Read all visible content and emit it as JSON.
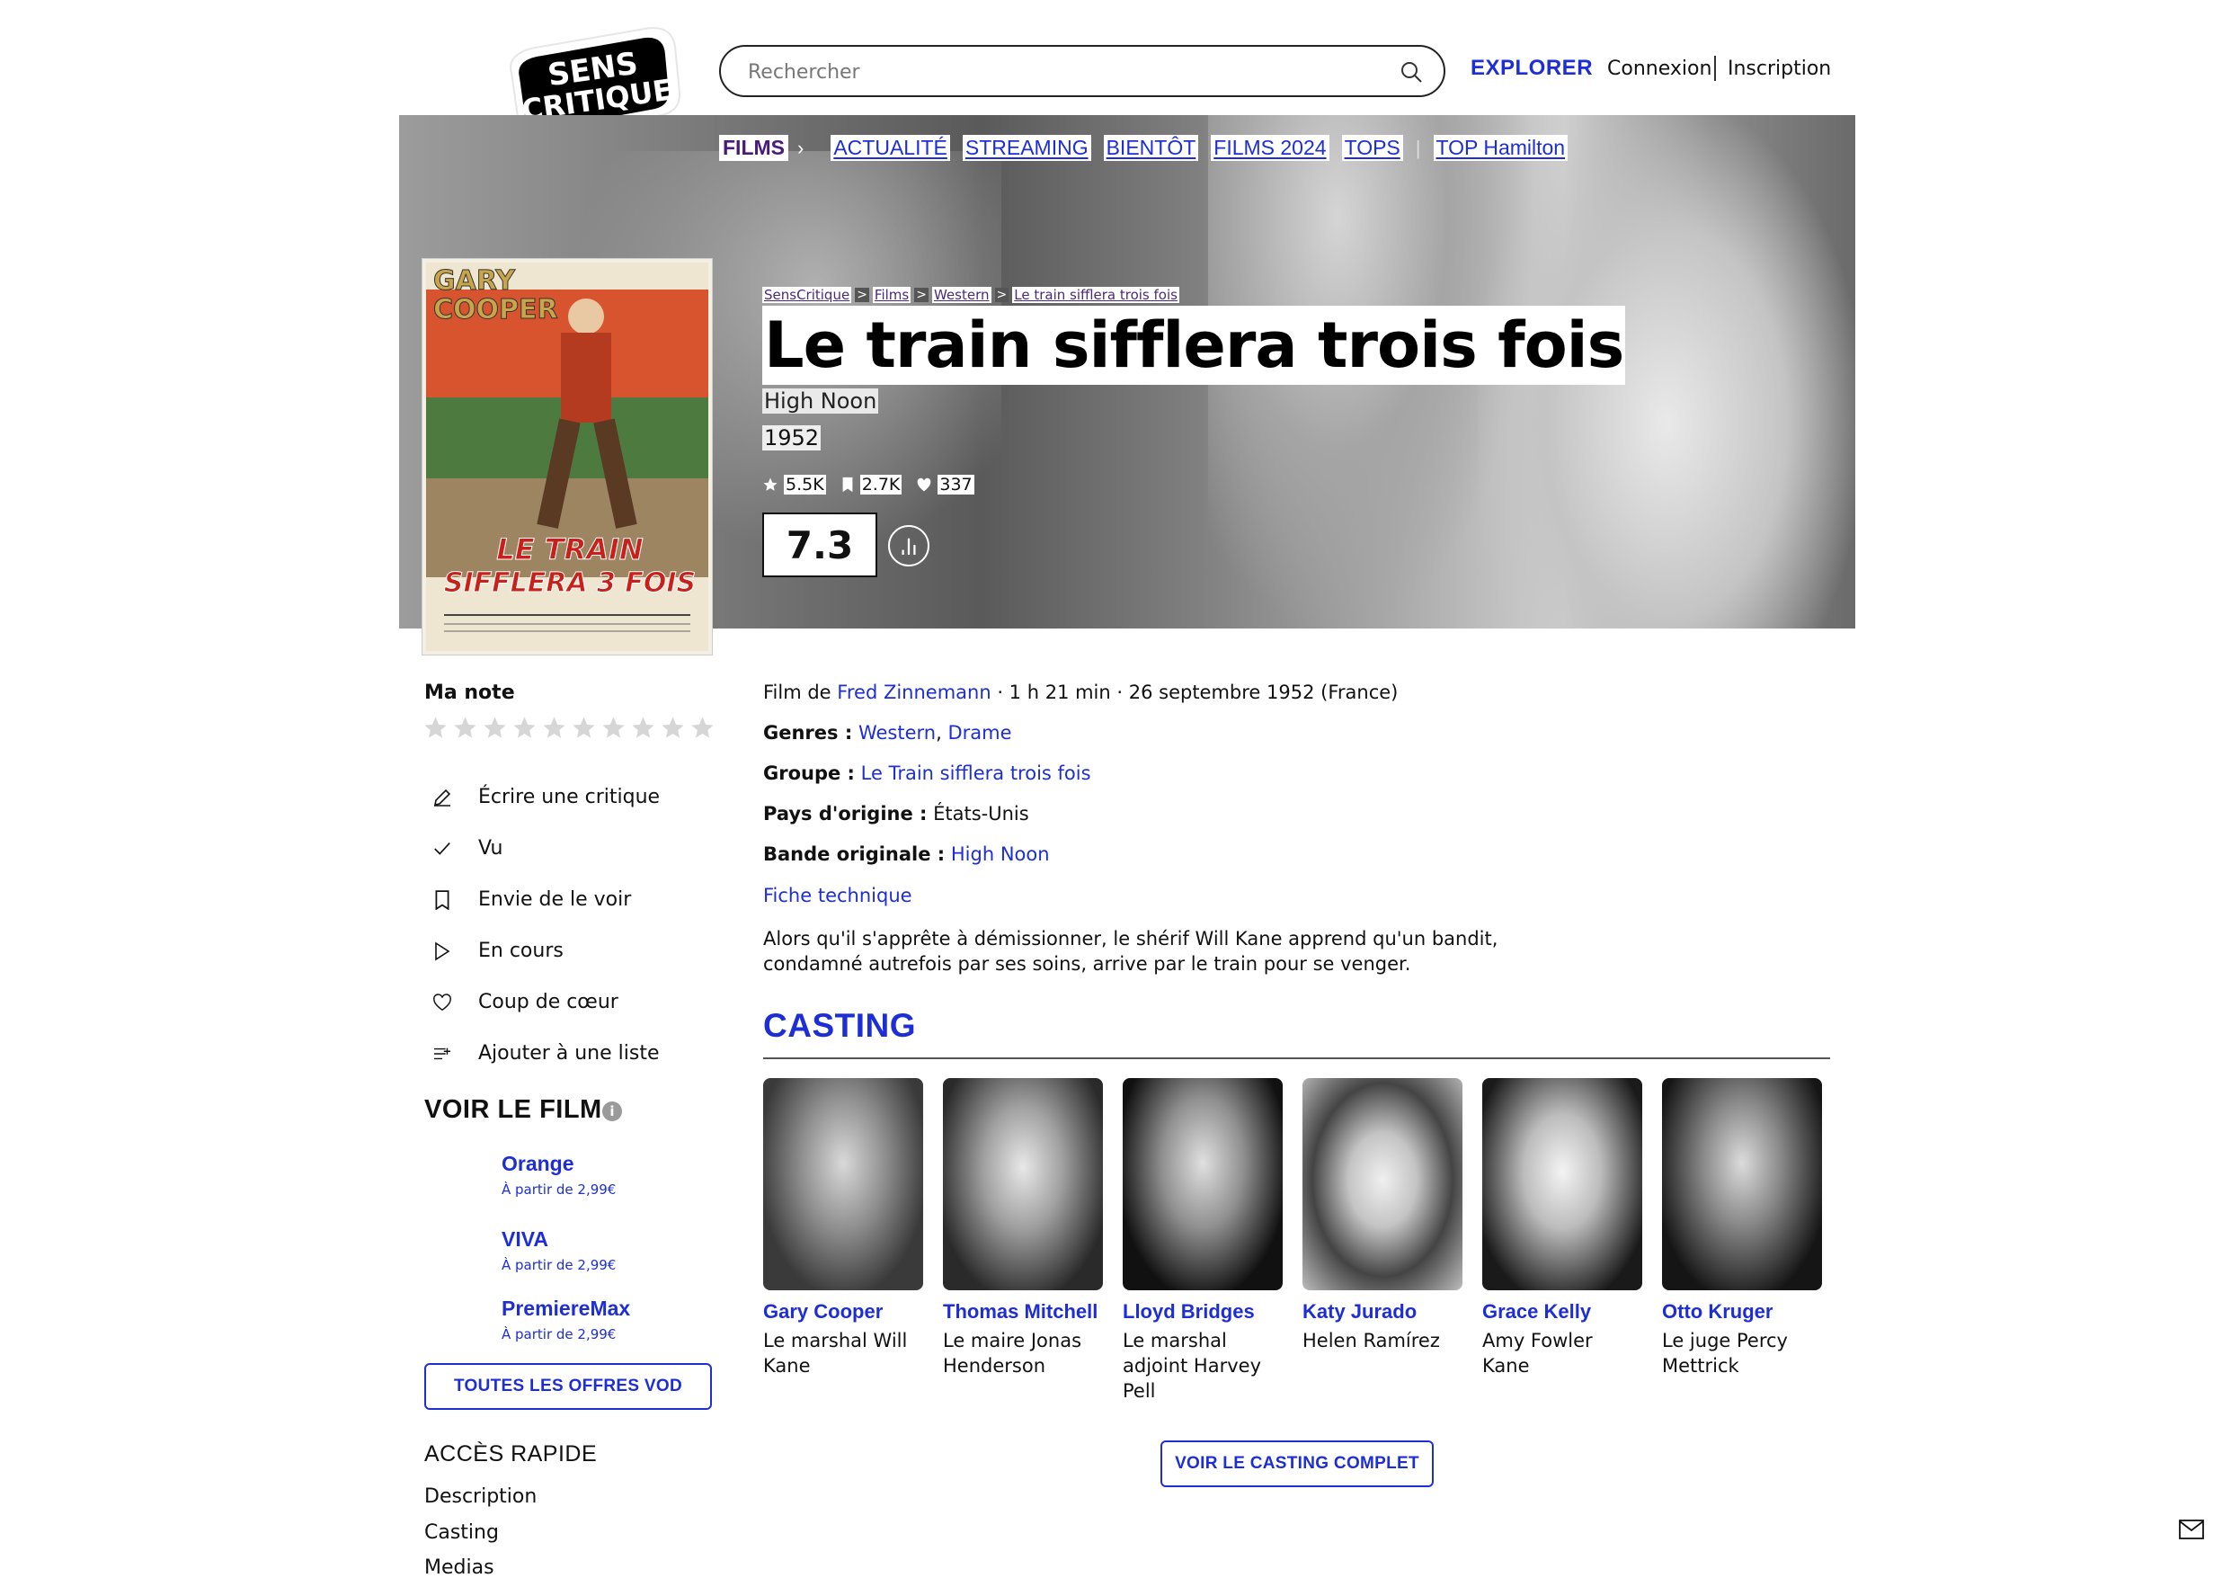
{
  "header": {
    "logo_text": [
      "SENS",
      "CRITIQUE"
    ],
    "search_placeholder": "Rechercher",
    "explorer": "EXPLORER",
    "connexion": "Connexion",
    "inscription": "Inscription"
  },
  "nav": {
    "films": "FILMS",
    "items": [
      "ACTUALITÉ",
      "STREAMING",
      "BIENTÔT",
      "FILMS 2024",
      "TOPS"
    ],
    "special": "TOP Hamilton"
  },
  "poster": {
    "top_text": [
      "GARY",
      "COOPER"
    ],
    "title_lines": [
      "LE TRAIN",
      "SIFFLERA 3 FOIS"
    ]
  },
  "breadcrumb": [
    "SensCritique",
    "Films",
    "Western",
    "Le train sifflera trois fois"
  ],
  "film": {
    "title": "Le train sifflera trois fois",
    "original_title": "High Noon",
    "year": "1952",
    "ratings_count": "5.5K",
    "wishlist_count": "2.7K",
    "likes_count": "337",
    "score": "7.3"
  },
  "left": {
    "ma_note": "Ma note",
    "star_count": 10,
    "actions": [
      {
        "label": "Écrire une critique",
        "icon": "pencil-icon"
      },
      {
        "label": "Vu",
        "icon": "check-icon"
      },
      {
        "label": "Envie de le voir",
        "icon": "bookmark-icon"
      },
      {
        "label": "En cours",
        "icon": "play-icon"
      },
      {
        "label": "Coup de cœur",
        "icon": "heart-icon"
      },
      {
        "label": "Ajouter à une liste",
        "icon": "add-list-icon"
      }
    ],
    "voir_title": "VOIR LE FILM",
    "vod": [
      {
        "name": "Orange",
        "price": "À partir de 2,99€"
      },
      {
        "name": "VIVA",
        "price": "À partir de 2,99€"
      },
      {
        "name": "PremiereMax",
        "price": "À partir de 2,99€"
      }
    ],
    "vod_button": "TOUTES LES OFFRES VOD",
    "acces_title": "ACCÈS RAPIDE",
    "quick_links": [
      "Description",
      "Casting",
      "Medias"
    ]
  },
  "details": {
    "film_de_label": "Film de",
    "director": "Fred Zinnemann",
    "meta": " · 1 h 21 min · 26 septembre 1952 (France)",
    "genres_label": "Genres :",
    "genre1": "Western",
    "genre_sep": ",",
    "genre2": "Drame",
    "groupe_label": "Groupe :",
    "groupe": "Le Train sifflera trois fois",
    "pays_label": "Pays d'origine :",
    "pays": "États-Unis",
    "bande_label": "Bande originale :",
    "bande": "High Noon",
    "fiche": "Fiche technique",
    "synopsis": "Alors qu'il s'apprête à démissionner, le shérif Will Kane apprend qu'un bandit, condamné autrefois par ses soins, arrive par le train pour se venger."
  },
  "casting": {
    "title": "CASTING",
    "actors": [
      {
        "name": "Gary Cooper",
        "role": "Le marshal Will Kane"
      },
      {
        "name": "Thomas Mitchell",
        "role": "Le maire Jonas Henderson"
      },
      {
        "name": "Lloyd Bridges",
        "role": "Le marshal adjoint Harvey Pell"
      },
      {
        "name": "Katy Jurado",
        "role": "Helen Ramírez"
      },
      {
        "name": "Grace Kelly",
        "role": "Amy Fowler Kane"
      },
      {
        "name": "Otto Kruger",
        "role": "Le juge Percy Mettrick"
      }
    ],
    "button": "VOIR LE CASTING COMPLET"
  },
  "colors": {
    "accent": "#1d2ed6",
    "nav_films": "#4a1a7a"
  }
}
